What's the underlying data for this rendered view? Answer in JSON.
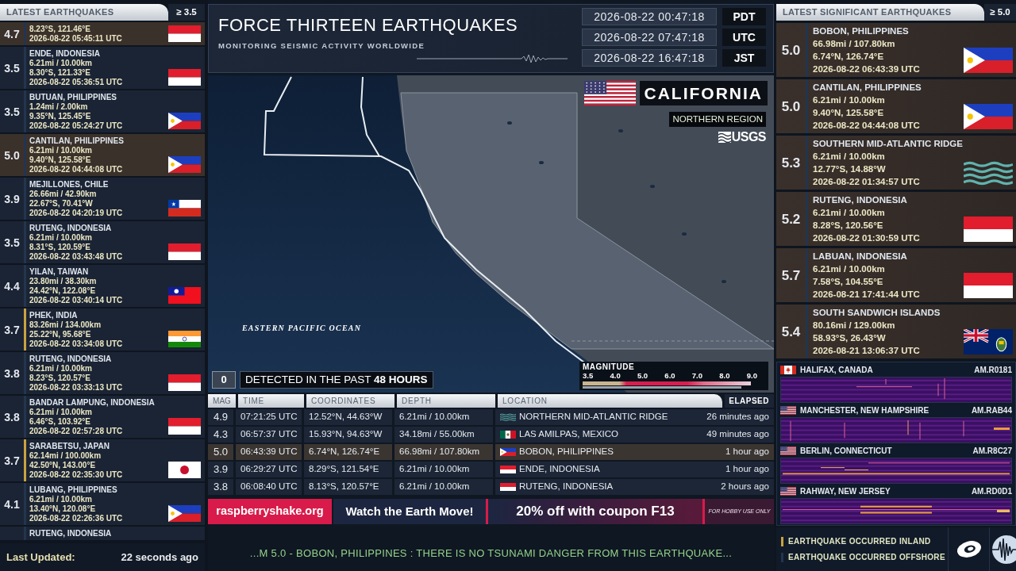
{
  "left_panel": {
    "title": "LATEST EARTHQUAKES",
    "threshold": "≥ 3.5",
    "quakes": [
      {
        "magnitude": "4.7",
        "coordinates": "8.23°S, 121.46°E",
        "time": "2026-08-22 05:45:11 UTC",
        "flag": {
          "kind": "indonesia"
        },
        "highlighted": true,
        "inland": false
      },
      {
        "magnitude": "3.5",
        "location": "ENDE, INDONESIA",
        "depth": "6.21mi / 10.00km",
        "coordinates": "8.30°S, 121.33°E",
        "time": "2026-08-22 05:36:51 UTC",
        "flag": {
          "kind": "indonesia"
        },
        "highlighted": false,
        "inland": false
      },
      {
        "magnitude": "3.5",
        "location": "BUTUAN, PHILIPPINES",
        "depth": "1.24mi / 2.00km",
        "coordinates": "9.35°N, 125.45°E",
        "time": "2026-08-22 05:24:27 UTC",
        "flag": {
          "kind": "philippines"
        },
        "highlighted": false,
        "inland": false
      },
      {
        "magnitude": "5.0",
        "location": "CANTILAN, PHILIPPINES",
        "depth": "6.21mi / 10.00km",
        "coordinates": "9.40°N, 125.58°E",
        "time": "2026-08-22 04:44:08 UTC",
        "flag": {
          "kind": "philippines"
        },
        "highlighted": true,
        "inland": false
      },
      {
        "magnitude": "3.9",
        "location": "MEJILLONES, CHILE",
        "depth": "26.66mi / 42.90km",
        "coordinates": "22.67°S, 70.41°W",
        "time": "2026-08-22 04:20:19 UTC",
        "flag": {
          "kind": "chile"
        },
        "highlighted": false,
        "inland": false
      },
      {
        "magnitude": "3.5",
        "location": "RUTENG, INDONESIA",
        "depth": "6.21mi / 10.00km",
        "coordinates": "8.31°S, 120.59°E",
        "time": "2026-08-22 03:43:48 UTC",
        "flag": {
          "kind": "indonesia"
        },
        "highlighted": false,
        "inland": false
      },
      {
        "magnitude": "4.4",
        "location": "YILAN, TAIWAN",
        "depth": "23.80mi / 38.30km",
        "coordinates": "24.42°N, 122.08°E",
        "time": "2026-08-22 03:40:14 UTC",
        "flag": {
          "kind": "taiwan"
        },
        "highlighted": false,
        "inland": false
      },
      {
        "magnitude": "3.7",
        "location": "PHEK, INDIA",
        "depth": "83.26mi / 134.00km",
        "coordinates": "25.22°N, 95.68°E",
        "time": "2026-08-22 03:34:08 UTC",
        "flag": {
          "kind": "india"
        },
        "highlighted": false,
        "inland": true
      },
      {
        "magnitude": "3.8",
        "location": "RUTENG, INDONESIA",
        "depth": "6.21mi / 10.00km",
        "coordinates": "8.23°S, 120.57°E",
        "time": "2026-08-22 03:33:13 UTC",
        "flag": {
          "kind": "indonesia"
        },
        "highlighted": false,
        "inland": false
      },
      {
        "magnitude": "3.8",
        "location": "BANDAR LAMPUNG, INDONESIA",
        "depth": "6.21mi / 10.00km",
        "coordinates": "6.46°S, 103.92°E",
        "time": "2026-08-22 02:57:28 UTC",
        "flag": {
          "kind": "indonesia"
        },
        "highlighted": false,
        "inland": false
      },
      {
        "magnitude": "3.7",
        "location": "SARABETSU, JAPAN",
        "depth": "62.14mi / 100.00km",
        "coordinates": "42.50°N, 143.00°E",
        "time": "2026-08-22 02:35:30 UTC",
        "flag": {
          "kind": "japan"
        },
        "highlighted": false,
        "inland": true
      },
      {
        "magnitude": "4.1",
        "location": "LUBANG, PHILIPPINES",
        "depth": "6.21mi / 10.00km",
        "coordinates": "13.40°N, 120.08°E",
        "time": "2026-08-22 02:26:36 UTC",
        "flag": {
          "kind": "philippines"
        },
        "highlighted": false,
        "inland": false
      },
      {
        "location": "RUTENG, INDONESIA",
        "highlighted": false,
        "inland": false
      }
    ],
    "last_updated_label": "Last Updated:",
    "last_updated_value": "22 seconds ago"
  },
  "header": {
    "title": "FORCE THIRTEEN EARTHQUAKES",
    "subtitle": "MONITORING SEISMIC ACTIVITY WORLDWIDE",
    "clocks": [
      {
        "date": "2026-08-22 00:47:18",
        "zone": "PDT"
      },
      {
        "date": "2026-08-22 07:47:18",
        "zone": "UTC"
      },
      {
        "date": "2026-08-22 16:47:18",
        "zone": "JST"
      }
    ]
  },
  "map": {
    "flag": {
      "kind": "usa"
    },
    "region": "CALIFORNIA",
    "subregion": "NORTHERN REGION",
    "source": "USGS",
    "ocean_label": "EASTERN PACIFIC OCEAN",
    "detected_count": "0",
    "detected_text": "DETECTED IN THE PAST **48 HOURS**",
    "magnitude_legend": {
      "title": "MAGNITUDE",
      "scale": [
        "3.5",
        "4.0",
        "5.0",
        "6.0",
        "7.0",
        "8.0",
        "9.0"
      ]
    }
  },
  "table": {
    "columns": [
      "MAG",
      "TIME",
      "COORDINATES",
      "DEPTH",
      "LOCATION",
      "ELAPSED"
    ],
    "rows": [
      {
        "magnitude": "4.9",
        "time": "07:21:25 UTC",
        "coordinates": "12.52°N, 44.63°W",
        "depth": "6.21mi / 10.00km",
        "flag": {
          "kind": "ocean"
        },
        "location": "NORTHERN MID-ATLANTIC RIDGE",
        "elapsed": "26 minutes ago",
        "highlighted": false
      },
      {
        "magnitude": "4.3",
        "time": "06:57:37 UTC",
        "coordinates": "15.93°N, 94.63°W",
        "depth": "34.18mi / 55.00km",
        "flag": {
          "kind": "mexico"
        },
        "location": "LAS AMILPAS, MEXICO",
        "elapsed": "49 minutes ago",
        "highlighted": false
      },
      {
        "magnitude": "5.0",
        "time": "06:43:39 UTC",
        "coordinates": "6.74°N, 126.74°E",
        "depth": "66.98mi / 107.80km",
        "flag": {
          "kind": "philippines"
        },
        "location": "BOBON, PHILIPPINES",
        "elapsed": "1 hour ago",
        "highlighted": true
      },
      {
        "magnitude": "3.9",
        "time": "06:29:27 UTC",
        "coordinates": "8.29°S, 121.54°E",
        "depth": "6.21mi / 10.00km",
        "flag": {
          "kind": "indonesia"
        },
        "location": "ENDE, INDONESIA",
        "elapsed": "1 hour ago",
        "highlighted": false
      },
      {
        "magnitude": "3.8",
        "time": "06:08:40 UTC",
        "coordinates": "8.13°S, 120.57°E",
        "depth": "6.21mi / 10.00km",
        "flag": {
          "kind": "indonesia"
        },
        "location": "RUTENG, INDONESIA",
        "elapsed": "2 hours ago",
        "highlighted": false
      }
    ]
  },
  "ad_bar": {
    "site": "raspberryshake.org",
    "slogan": "Watch the Earth Move!",
    "offer": "20% off with coupon F13",
    "note": "FOR HOBBY USE ONLY"
  },
  "ticker": "...M 5.0 - BOBON, PHILIPPINES : THERE IS NO TSUNAMI DANGER FROM THIS EARTHQUAKE...",
  "right_panel": {
    "title": "LATEST SIGNIFICANT EARTHQUAKES",
    "threshold": "≥ 5.0",
    "quakes": [
      {
        "magnitude": "5.0",
        "location": "BOBON, PHILIPPINES",
        "depth": "66.98mi / 107.80km",
        "coordinates": "6.74°N, 126.74°E",
        "time": "2026-08-22 06:43:39 UTC",
        "flag": {
          "kind": "philippines"
        },
        "inland": false
      },
      {
        "magnitude": "5.0",
        "location": "CANTILAN, PHILIPPINES",
        "depth": "6.21mi / 10.00km",
        "coordinates": "9.40°N, 125.58°E",
        "time": "2026-08-22 04:44:08 UTC",
        "flag": {
          "kind": "philippines"
        },
        "inland": false
      },
      {
        "magnitude": "5.3",
        "location": "SOUTHERN MID-ATLANTIC RIDGE",
        "depth": "6.21mi / 10.00km",
        "coordinates": "12.77°S, 14.88°W",
        "time": "2026-08-22 01:34:57 UTC",
        "flag": {
          "kind": "ocean"
        },
        "inland": false
      },
      {
        "magnitude": "5.2",
        "location": "RUTENG, INDONESIA",
        "depth": "6.21mi / 10.00km",
        "coordinates": "8.28°S, 120.56°E",
        "time": "2026-08-22 01:30:59 UTC",
        "flag": {
          "kind": "indonesia"
        },
        "inland": false
      },
      {
        "magnitude": "5.7",
        "location": "LABUAN, INDONESIA",
        "depth": "6.21mi / 10.00km",
        "coordinates": "7.58°S, 104.55°E",
        "time": "2026-08-21 17:41:44 UTC",
        "flag": {
          "kind": "indonesia"
        },
        "inland": false
      },
      {
        "magnitude": "5.4",
        "location": "SOUTH SANDWICH ISLANDS",
        "depth": "80.16mi / 129.00km",
        "coordinates": "58.93°S, 26.43°W",
        "time": "2026-08-21 13:06:37 UTC",
        "flag": {
          "kind": "south_georgia"
        },
        "inland": false
      }
    ],
    "stations": [
      {
        "flag": {
          "kind": "canada"
        },
        "name": "HALIFAX, CANADA",
        "code": "AM.R0181"
      },
      {
        "flag": {
          "kind": "usa"
        },
        "name": "MANCHESTER, NEW HAMPSHIRE",
        "code": "AM.RAB44"
      },
      {
        "flag": {
          "kind": "usa"
        },
        "name": "BERLIN, CONNECTICUT",
        "code": "AM.R8C27"
      },
      {
        "flag": {
          "kind": "usa"
        },
        "name": "RAHWAY, NEW JERSEY",
        "code": "AM.RD0D1"
      }
    ],
    "legend": [
      {
        "kind": "inland",
        "label": "EARTHQUAKE OCCURRED INLAND"
      },
      {
        "kind": "offshore",
        "label": "EARTHQUAKE OCCURRED OFFSHORE"
      }
    ]
  }
}
